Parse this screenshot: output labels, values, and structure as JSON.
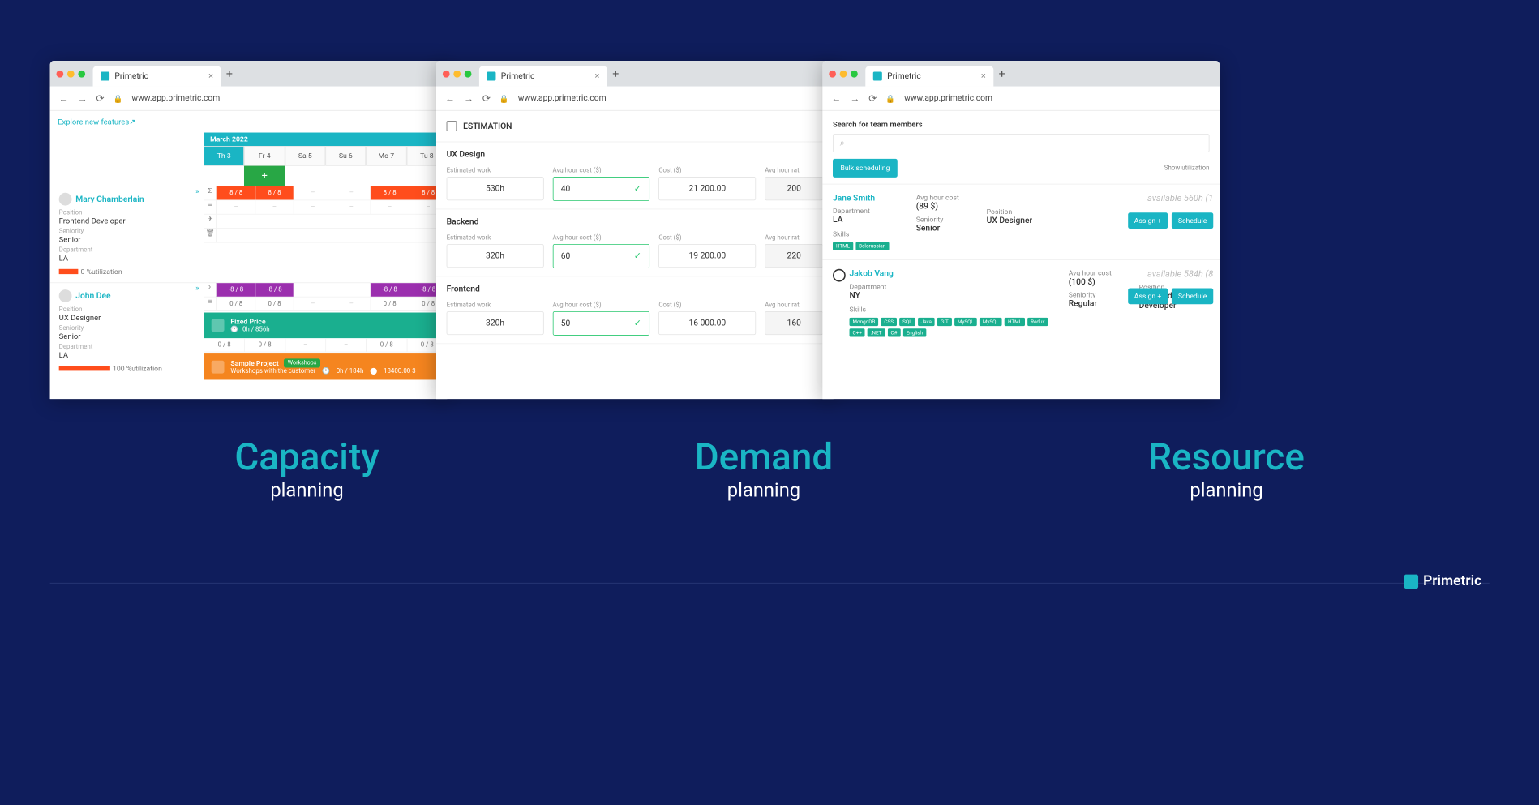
{
  "browser": {
    "tab_title": "Primetric",
    "url": "www.app.primetric.com"
  },
  "panel1": {
    "explore": "Explore new features",
    "month": "March 2022",
    "days": [
      "Th 3",
      "Fr 4",
      "Sa 5",
      "Su 6",
      "Mo 7",
      "Tu 8"
    ],
    "people": [
      {
        "name": "Mary Chamberlain",
        "position_label": "Position",
        "position": "Frontend Developer",
        "seniority_label": "Seniority",
        "seniority": "Senior",
        "dept_label": "Department",
        "dept": "LA",
        "util": "0 %utilization",
        "row1": [
          "8 / 8",
          "8 / 8",
          "–",
          "–",
          "8 / 8",
          "8 / 8"
        ],
        "row2": [
          "–",
          "–",
          "–",
          "–",
          "–",
          "–"
        ]
      },
      {
        "name": "John Dee",
        "position_label": "Position",
        "position": "UX Designer",
        "seniority_label": "Seniority",
        "seniority": "Senior",
        "dept_label": "Department",
        "dept": "LA",
        "util": "100 %utilization",
        "row1": [
          "-8 / 8",
          "-8 / 8",
          "–",
          "–",
          "-8 / 8",
          "-8 / 8"
        ],
        "row2": [
          "0 / 8",
          "0 / 8",
          "–",
          "–",
          "0 / 8",
          "0 / 8"
        ]
      }
    ],
    "proj1": {
      "title": "Fixed Price",
      "sub": "0h / 856h"
    },
    "countrow": [
      "0 / 8",
      "0 / 8",
      "–",
      "–",
      "0 / 8",
      "0 / 8"
    ],
    "proj2": {
      "title": "Sample Project",
      "badge": "Workshops",
      "sub": "Workshops with the customer",
      "hours": "0h / 184h",
      "money": "18400.00 $"
    }
  },
  "panel2": {
    "title": "ESTIMATION",
    "sections": [
      {
        "name": "UX Design",
        "est_label": "Estimated work",
        "est": "530h",
        "avg_label": "Avg hour cost ($)",
        "avg": "40",
        "cost_label": "Cost ($)",
        "cost": "21 200.00",
        "rate_label": "Avg hour rat",
        "rate": "200"
      },
      {
        "name": "Backend",
        "est_label": "Estimated work",
        "est": "320h",
        "avg_label": "Avg hour cost ($)",
        "avg": "60",
        "cost_label": "Cost ($)",
        "cost": "19 200.00",
        "rate_label": "Avg hour rat",
        "rate": "220"
      },
      {
        "name": "Frontend",
        "est_label": "Estimated work",
        "est": "320h",
        "avg_label": "Avg hour cost ($)",
        "avg": "50",
        "cost_label": "Cost ($)",
        "cost": "16 000.00",
        "rate_label": "Avg hour rat",
        "rate": "160"
      }
    ]
  },
  "panel3": {
    "search_label": "Search for team members",
    "bulk": "Bulk scheduling",
    "show": "Show utilization",
    "assign": "Assign +",
    "schedule": "Schedule",
    "members": [
      {
        "name": "Jane Smith",
        "cost_label": "Avg hour cost",
        "cost": "(89 $)",
        "dept_label": "Department",
        "dept": "LA",
        "sen_label": "Seniority",
        "sen": "Senior",
        "pos_label": "Position",
        "pos": "UX Designer",
        "avail": "available 560h (1",
        "skills_label": "Skills",
        "skills": [
          "HTML",
          "Belorussian"
        ]
      },
      {
        "name": "Jakob Vang",
        "cost_label": "Avg hour cost",
        "cost": "(100 $)",
        "dept_label": "Department",
        "dept": "NY",
        "sen_label": "Seniority",
        "sen": "Regular",
        "pos_label": "Position",
        "pos": "Frontend Developer",
        "avail": "available 584h (8",
        "skills_label": "Skills",
        "skills": [
          "MongoDB",
          "CSS",
          "SQL",
          "Java",
          "GIT",
          "MySQL",
          "MySQL",
          "HTML",
          "Redux",
          "C++",
          ".NET",
          "C#",
          "English"
        ]
      }
    ]
  },
  "heads": [
    {
      "big": "Capacity",
      "sm": "planning"
    },
    {
      "big": "Demand",
      "sm": "planning"
    },
    {
      "big": "Resource",
      "sm": "planning"
    }
  ],
  "brand": "Primetric"
}
